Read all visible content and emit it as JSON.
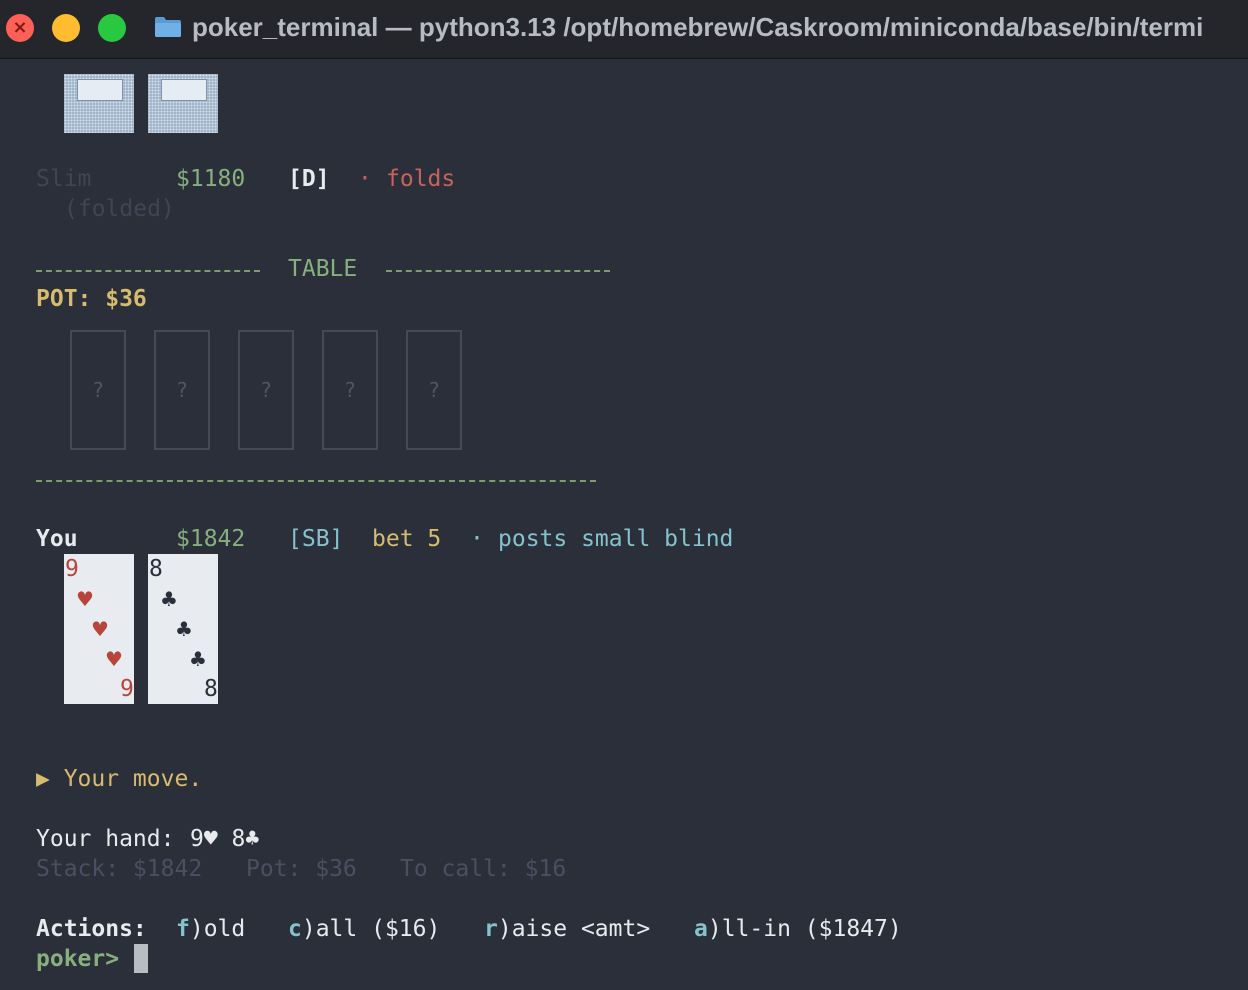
{
  "window": {
    "title": "poker_terminal — python3.13 /opt/homebrew/Caskroom/miniconda/base/bin/termi"
  },
  "opponent": {
    "name": "Slim",
    "stack": "$1180",
    "position": "[D]",
    "sep": "·",
    "action": "folds",
    "status": "(folded)"
  },
  "table": {
    "label": "TABLE",
    "pot_label": "POT: $36",
    "community_cards": [
      "?",
      "?",
      "?",
      "?",
      "?"
    ]
  },
  "player": {
    "name": "You",
    "stack": "$1842",
    "position": "[SB]",
    "bet": "bet 5",
    "sep": "·",
    "action": "posts small blind",
    "cards": [
      {
        "rank": "9",
        "suit": "♥",
        "color": "#b7453c"
      },
      {
        "rank": "8",
        "suit": "♣",
        "color": "#2b2f3a"
      }
    ]
  },
  "prompt_area": {
    "move": "▶ Your move.",
    "hand_label": "Your hand:",
    "hand_value": "9♥ 8♣",
    "stack": "Stack: $1842",
    "pot": "Pot: $36",
    "to_call": "To call: $16",
    "actions_label": "Actions:",
    "fold_key": "f",
    "fold_rest": ")old",
    "call_key": "c",
    "call_rest": ")all ($16)",
    "raise_key": "r",
    "raise_rest": ")aise <amt>",
    "allin_key": "a",
    "allin_rest": ")ll-in ($1847)",
    "prompt": "poker>"
  },
  "colors": {
    "background": "#2b2f3a",
    "green": "#88b07e",
    "red": "#c7635a",
    "yellow": "#d7bb6e",
    "cyan": "#86c2cc"
  }
}
